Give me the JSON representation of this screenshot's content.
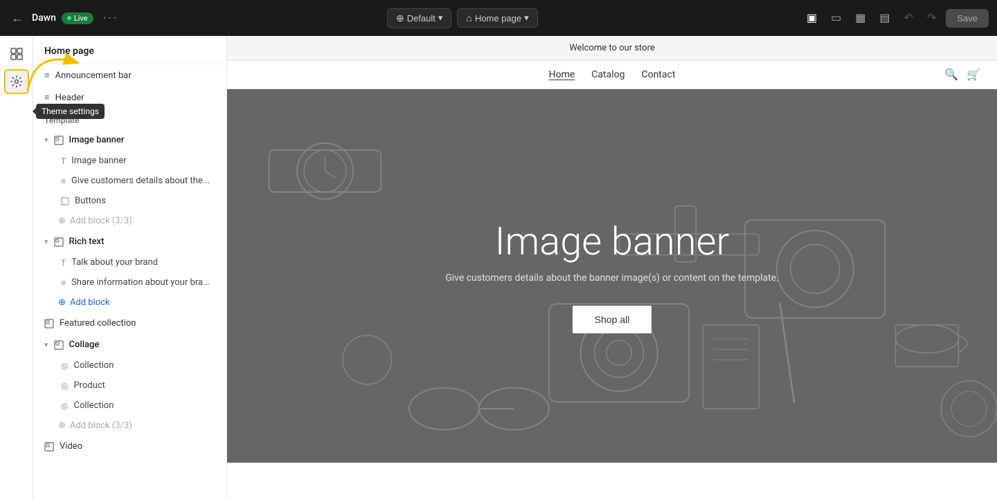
{
  "topbar": {
    "back_label": "←",
    "store_name": "Dawn",
    "live_label": "Live",
    "more_label": "···",
    "preset_label": "Default",
    "page_label": "Home page",
    "save_label": "Save"
  },
  "sidebar_icons": {
    "grid_icon": "⊞",
    "gear_icon": "⚙",
    "tooltip_label": "Theme settings"
  },
  "panel": {
    "title": "Home page",
    "items": [
      {
        "id": "announcement-bar",
        "label": "Announcement bar",
        "icon": "≡",
        "indent": 1
      },
      {
        "id": "header",
        "label": "Header",
        "icon": "≡",
        "indent": 1
      }
    ],
    "template_label": "Template",
    "sections": [
      {
        "id": "image-banner",
        "label": "Image banner",
        "icon": "▣",
        "expanded": true,
        "children": [
          {
            "id": "image-banner-heading",
            "label": "Image banner",
            "icon": "T"
          },
          {
            "id": "image-banner-text",
            "label": "Give customers details about the...",
            "icon": "≡"
          },
          {
            "id": "image-banner-buttons",
            "label": "Buttons",
            "icon": "▣"
          }
        ],
        "add_block": "Add block (3/3)"
      },
      {
        "id": "rich-text",
        "label": "Rich text",
        "icon": "▣",
        "expanded": true,
        "children": [
          {
            "id": "rich-text-heading",
            "label": "Talk about your brand",
            "icon": "T"
          },
          {
            "id": "rich-text-body",
            "label": "Share information about your bra...",
            "icon": "≡"
          }
        ],
        "add_block": "Add block",
        "add_block_blue": true
      },
      {
        "id": "featured-collection",
        "label": "Featured collection",
        "icon": "▣",
        "expanded": false
      },
      {
        "id": "collage",
        "label": "Collage",
        "icon": "▣",
        "expanded": true,
        "children": [
          {
            "id": "collage-collection-1",
            "label": "Collection",
            "icon": "◎"
          },
          {
            "id": "collage-product",
            "label": "Product",
            "icon": "◎"
          },
          {
            "id": "collage-collection-2",
            "label": "Collection",
            "icon": "◎"
          }
        ],
        "add_block": "Add block (3/3)"
      },
      {
        "id": "video",
        "label": "Video",
        "icon": "▣",
        "expanded": false
      }
    ]
  },
  "preview": {
    "announcement": "Welcome to our store",
    "nav_links": [
      "Home",
      "Catalog",
      "Contact"
    ],
    "active_nav": "Home",
    "banner_title": "Image banner",
    "banner_subtitle": "Give customers details about the banner image(s) or content on the template.",
    "banner_cta": "Shop all"
  },
  "colors": {
    "live_green": "#1c7a3a",
    "add_block_blue": "#2060d9",
    "topbar_bg": "#1a1a1a",
    "sidebar_bg": "#ffffff"
  }
}
